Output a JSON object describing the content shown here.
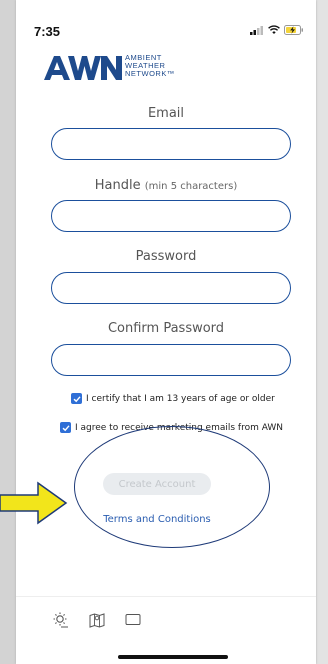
{
  "status": {
    "time": "7:35"
  },
  "brand": {
    "logo_letters": "AWN",
    "line1": "AMBIENT",
    "line2": "WEATHER",
    "line3": "NETWORK™"
  },
  "form": {
    "email_label": "Email",
    "handle_label": "Handle",
    "handle_hint": "(min 5 characters)",
    "password_label": "Password",
    "confirm_label": "Confirm Password",
    "email_value": "",
    "handle_value": "",
    "password_value": "",
    "confirm_value": ""
  },
  "checks": {
    "age_label": "I certify that I am 13 years of age or older",
    "age_checked": true,
    "marketing_label": "I agree to receive marketing emails from AWN",
    "marketing_checked": true
  },
  "actions": {
    "create_label": "Create Account",
    "terms_label": "Terms and Conditions"
  },
  "nav": {
    "items": [
      "weather-icon",
      "map-icon",
      "message-icon"
    ]
  },
  "colors": {
    "accent": "#1b4f9c",
    "checkbox": "#2f6fd6",
    "link": "#2a5db0",
    "arrow": "#f2e51b"
  }
}
